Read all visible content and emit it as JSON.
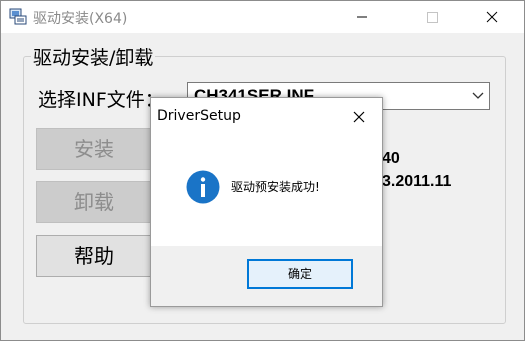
{
  "window": {
    "title": "驱动安装(X64)",
    "app_icon": "installer-icon",
    "controls": {
      "minimize_icon": "minimize-icon",
      "maximize_icon": "maximize-icon",
      "close_icon": "close-icon"
    }
  },
  "group": {
    "title": "驱动安装/卸载",
    "inf_label": "选择INF文件：",
    "inf_value": "CH341SER.INF"
  },
  "buttons": {
    "install": "安装",
    "uninstall": "卸载",
    "help": "帮助"
  },
  "info": {
    "line1": "40",
    "line2": "3.2011.11"
  },
  "dialog": {
    "title": "DriverSetup",
    "message": "驱动预安装成功!",
    "ok_label": "确定",
    "icon": "info-icon"
  },
  "colors": {
    "accent": "#0078d7",
    "info_icon": "#1a74c7"
  }
}
